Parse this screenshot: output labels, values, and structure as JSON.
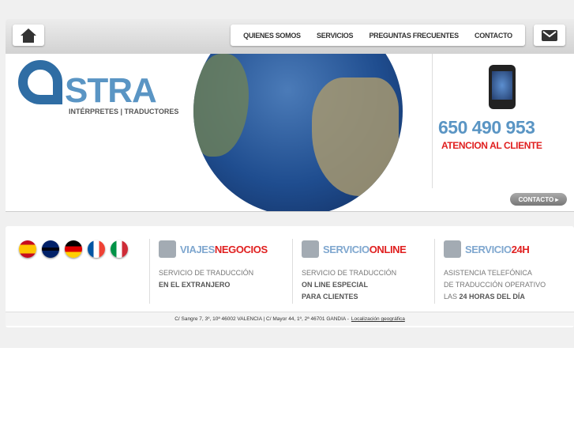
{
  "nav": {
    "items": [
      "QUIENES SOMOS",
      "SERVICIOS",
      "PREGUNTAS FRECUENTES",
      "CONTACTO"
    ]
  },
  "logo": {
    "text": "STRA",
    "subtitle": "INTÉRPRETES | TRADUCTORES"
  },
  "contact": {
    "phone": "650 490 953",
    "tagline": "ATENCION AL CLIENTE",
    "button": "CONTACTO ▸"
  },
  "flags": [
    "es",
    "en",
    "de",
    "fr",
    "it"
  ],
  "services": [
    {
      "title_a": "VIAJES ",
      "title_b": "NEGOCIOS",
      "line1": "SERVICIO DE TRADUCCIÓN",
      "line2": "EN EL EXTRANJERO",
      "line3": ""
    },
    {
      "title_a": "SERVICIO ",
      "title_b": "ONLINE",
      "line1": "SERVICIO DE TRADUCCIÓN",
      "line2": "ON LINE ESPECIAL",
      "line3": "PARA CLIENTES"
    },
    {
      "title_a": "SERVICIO ",
      "title_b": "24H",
      "line1": "ASISTENCIA TELEFÓNICA",
      "line2": "DE TRADUCCIÓN OPERATIVO",
      "line3_a": "LAS ",
      "line3_b": "24 HORAS DEL DÍA"
    }
  ],
  "footer": {
    "address": "C/ Sangre 7, 3º, 10ª 46002 VALENCIA | C/ Mayor 44, 1º, 2ª 46701 GANDIA -",
    "link": "Localización geográfica"
  }
}
